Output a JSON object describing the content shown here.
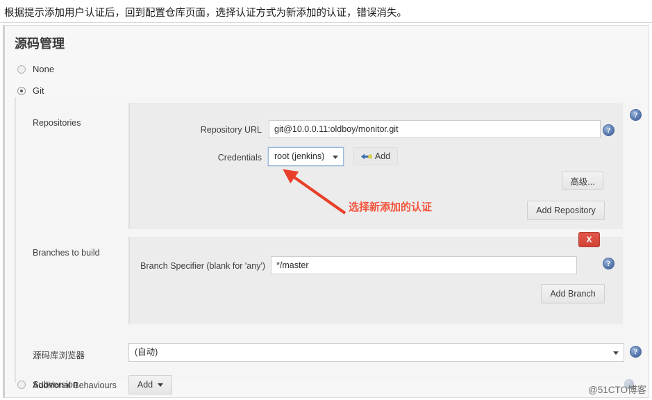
{
  "note": {
    "text": "根据提示添加用户认证后，回到配置仓库页面，选择认证方式为新添加的认证，错误消失。"
  },
  "page": {
    "title": "源码管理"
  },
  "scm_options": [
    {
      "label": "None",
      "checked": false
    },
    {
      "label": "Git",
      "checked": true
    },
    {
      "label": "Subversion",
      "checked": false
    }
  ],
  "repositories": {
    "section_label": "Repositories",
    "repository_url": {
      "label": "Repository URL",
      "value": "git@10.0.0.11:oldboy/monitor.git"
    },
    "credentials": {
      "label": "Credentials",
      "value": "root (jenkins)"
    },
    "add_credentials_button": "Add",
    "advanced_button": "高级...",
    "add_repository_button": "Add Repository"
  },
  "branches": {
    "section_label": "Branches to build",
    "branch_specifier": {
      "label": "Branch Specifier (blank for 'any')",
      "value": "*/master"
    },
    "delete_button": "X",
    "add_branch_button": "Add Branch"
  },
  "repo_browser": {
    "label": "源码库浏览器",
    "value": "(自动)"
  },
  "additional_behaviours": {
    "label": "Additional Behaviours",
    "add_button": "Add"
  },
  "help": {
    "glyph": "?"
  },
  "annotation": {
    "text": "选择新添加的认证",
    "color": "#f4543c"
  },
  "watermark": {
    "text": "@51CTO博客"
  }
}
